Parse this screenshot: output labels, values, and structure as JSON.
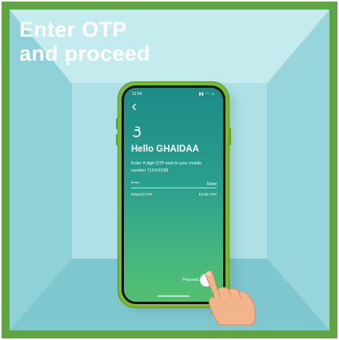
{
  "headline": {
    "line1": "Enter OTP",
    "line2": "and proceed"
  },
  "phone": {
    "status_bar": {
      "time": "12:54",
      "icons": "signal-wifi-battery"
    },
    "back_icon": "chevron-left-icon",
    "logo_icon": "brand-logo-icon",
    "greeting": "Hello GHAIDAA",
    "subtitle": "Enter 4 digit OTP sent to your mobile number 71XXXX38",
    "otp_input": {
      "value": "••••",
      "show_label": "Show"
    },
    "resend_label": "Resend OTP",
    "email_label": "Email OTP",
    "proceed_label": "Proceed"
  },
  "colors": {
    "frame": "#5fa643",
    "room": "#a9dde3",
    "phone_case": "#7cb92d",
    "screen_top": "#1d8b86",
    "screen_bottom": "#52c070"
  }
}
